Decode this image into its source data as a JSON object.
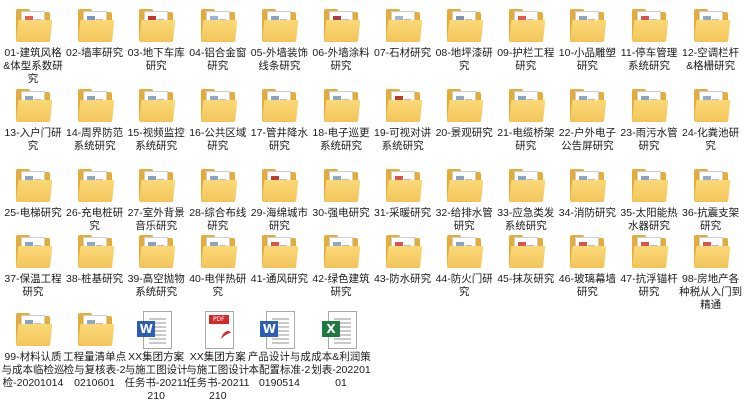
{
  "colors": {
    "folder": "#f2c55a",
    "pdf": "#d32b2b",
    "word": "#2b5fb4",
    "excel": "#1f7a40"
  },
  "items": [
    {
      "label": "01-建筑风格&体型系数研究",
      "icon": "folder-icon",
      "accent": "#e95d4f"
    },
    {
      "label": "02-墙率研究",
      "icon": "folder-icon",
      "accent": "#7a95c9"
    },
    {
      "label": "03-地下车库研究",
      "icon": "folder-icon",
      "accent": "#c0392b"
    },
    {
      "label": "04-铝合金窗研究",
      "icon": "folder-icon",
      "accent": "#9bb6d4"
    },
    {
      "label": "05-外墙装饰线条研究",
      "icon": "folder-icon",
      "accent": "#8aa2c2"
    },
    {
      "label": "06-外墙涂料研究",
      "icon": "folder-icon",
      "accent": "#b23a48"
    },
    {
      "label": "07-石材研究",
      "icon": "folder-icon",
      "accent": "#9fb6cf"
    },
    {
      "label": "08-地坪漆研究",
      "icon": "folder-icon",
      "accent": "#7d94b8"
    },
    {
      "label": "09-护栏工程研究",
      "icon": "folder-icon",
      "accent": "#e05a4e"
    },
    {
      "label": "10-小品雕塑研究",
      "icon": "folder-icon",
      "accent": "#8fa7c4"
    },
    {
      "label": "11-停车管理系统研究",
      "icon": "folder-icon",
      "accent": "#d9534f"
    },
    {
      "label": "12-空调栏杆&格栅研究",
      "icon": "folder-icon",
      "accent": "#90a9c8"
    },
    {
      "label": "13-入户门研究",
      "icon": "folder-icon",
      "accent": "#8ea6c5"
    },
    {
      "label": "14-周界防范系统研究",
      "icon": "folder-icon",
      "accent": "#8aa3c1"
    },
    {
      "label": "15-视频监控系统研究",
      "icon": "folder-icon",
      "accent": "#8fa8c6"
    },
    {
      "label": "16-公共区域研究",
      "icon": "folder-icon",
      "accent": "#93abc8"
    },
    {
      "label": "17-管井降水研究",
      "icon": "folder-icon",
      "accent": "#8aa1c0"
    },
    {
      "label": "18-电子巡更系统研究",
      "icon": "folder-icon",
      "accent": "#8ca5c4"
    },
    {
      "label": "19-可视对讲系统研究",
      "icon": "folder-icon",
      "accent": "#c0392b"
    },
    {
      "label": "20-景观研究",
      "icon": "folder-icon",
      "accent": "#8fa8c6"
    },
    {
      "label": "21-电缆桥架研究",
      "icon": "folder-icon",
      "accent": "#8ba4c3"
    },
    {
      "label": "22-户外电子公告屏研究",
      "icon": "folder-icon",
      "accent": "#8fa8c6"
    },
    {
      "label": "23-雨污水管研究",
      "icon": "folder-icon",
      "accent": "#8aa3c1"
    },
    {
      "label": "24-化粪池研究",
      "icon": "folder-icon",
      "accent": "#93abc8"
    },
    {
      "label": "25-电梯研究",
      "icon": "folder-icon",
      "accent": "#8ca5c4"
    },
    {
      "label": "26-充电桩研究",
      "icon": "folder-icon",
      "accent": "#8fa8c6"
    },
    {
      "label": "27-室外背景音乐研究",
      "icon": "folder-icon",
      "accent": "#8aa1c0"
    },
    {
      "label": "28-综合布线研究",
      "icon": "folder-icon",
      "accent": "#8ba4c3"
    },
    {
      "label": "29-海绵城市研究",
      "icon": "folder-icon",
      "accent": "#c0392b"
    },
    {
      "label": "30-强电研究",
      "icon": "folder-icon",
      "accent": "#8fa8c6"
    },
    {
      "label": "31-采暖研究",
      "icon": "folder-icon",
      "accent": "#d9534f"
    },
    {
      "label": "32-给排水管研究",
      "icon": "folder-icon",
      "accent": "#8aa3c1"
    },
    {
      "label": "33-应急类发系统研究",
      "icon": "folder-icon",
      "accent": "#8ca5c4"
    },
    {
      "label": "34-消防研究",
      "icon": "folder-icon",
      "accent": "#8fa8c6"
    },
    {
      "label": "35-太阳能热水器研究",
      "icon": "folder-icon",
      "accent": "#8ba4c3"
    },
    {
      "label": "36-抗震支架研究",
      "icon": "folder-icon",
      "accent": "#93abc8"
    },
    {
      "label": "37-保温工程研究",
      "icon": "folder-icon",
      "accent": "#8ca5c4"
    },
    {
      "label": "38-桩基研究",
      "icon": "folder-icon",
      "accent": "#8fa8c6"
    },
    {
      "label": "39-高空抛物系统研究",
      "icon": "folder-icon",
      "accent": "#8aa1c0"
    },
    {
      "label": "40-电伴热研究",
      "icon": "folder-icon",
      "accent": "#8ba4c3"
    },
    {
      "label": "41-通风研究",
      "icon": "folder-icon",
      "accent": "#d9534f"
    },
    {
      "label": "42-绿色建筑研究",
      "icon": "folder-icon",
      "accent": "#8fa8c6"
    },
    {
      "label": "43-防水研究",
      "icon": "folder-icon",
      "accent": "#d9534f"
    },
    {
      "label": "44-防火门研究",
      "icon": "folder-icon",
      "accent": "#8aa3c1"
    },
    {
      "label": "45-抹灰研究",
      "icon": "folder-icon",
      "accent": "#d9534f"
    },
    {
      "label": "46-玻璃幕墙研究",
      "icon": "folder-icon",
      "accent": "#d9534f"
    },
    {
      "label": "47-抗浮锚杆研究",
      "icon": "folder-icon",
      "accent": "#d9534f"
    },
    {
      "label": "98-房地产各种税从入门到精通",
      "icon": "folder-icon",
      "accent": "#d9534f"
    },
    {
      "label": "99-材料认质与成本临检巡检-20201014",
      "icon": "folder-icon",
      "accent": "#8aa3c1"
    },
    {
      "label": "工程量清单点检与复核表-20210601",
      "icon": "folder-icon",
      "accent": "#8fa8c6"
    },
    {
      "label": "XX集团方案与施工图设计任务书-20211210",
      "icon": "word-doc-icon",
      "badge": "W"
    },
    {
      "label": "XX集团方案与施工图设计任务书-20211210",
      "icon": "pdf-doc-icon",
      "badge": "PDF"
    },
    {
      "label": "产品设计与成本配置标准-20190514",
      "icon": "word-doc-icon",
      "badge": "W"
    },
    {
      "label": "成本&利润策划表-20220101",
      "icon": "excel-doc-icon",
      "badge": "X"
    }
  ]
}
